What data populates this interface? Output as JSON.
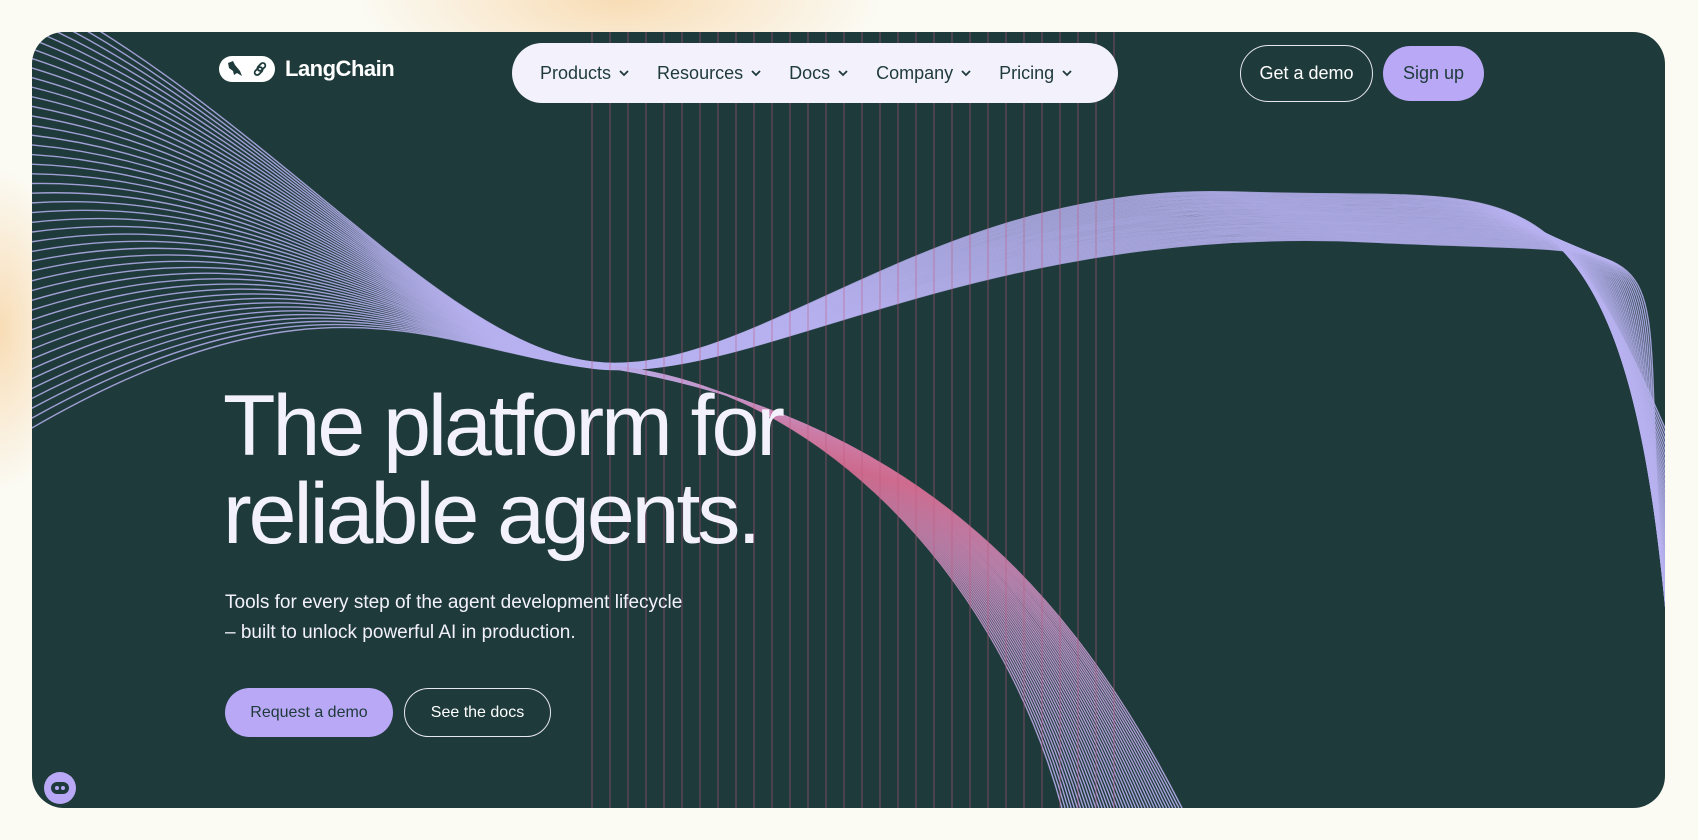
{
  "brand": {
    "name": "LangChain"
  },
  "nav": {
    "items": [
      {
        "label": "Products"
      },
      {
        "label": "Resources"
      },
      {
        "label": "Docs"
      },
      {
        "label": "Company"
      },
      {
        "label": "Pricing"
      }
    ]
  },
  "header_actions": {
    "get_demo": "Get a demo",
    "sign_up": "Sign up"
  },
  "hero": {
    "headline_line1": "The platform for",
    "headline_line2": "reliable agents.",
    "subtext_line1": "Tools for every step of the agent development lifecycle",
    "subtext_line2": "– built to unlock powerful AI in production.",
    "cta_primary": "Request a demo",
    "cta_secondary": "See the docs"
  },
  "colors": {
    "hero_bg": "#1e3a3a",
    "accent_purple": "#b8a8f5",
    "wave_lavender": "#b7b1f0",
    "wave_pink": "#d16b8f",
    "page_bg": "#fbfaf3"
  },
  "icons": [
    "bird-icon",
    "link-icon",
    "chevron-down-icon",
    "chat-widget-icon"
  ]
}
